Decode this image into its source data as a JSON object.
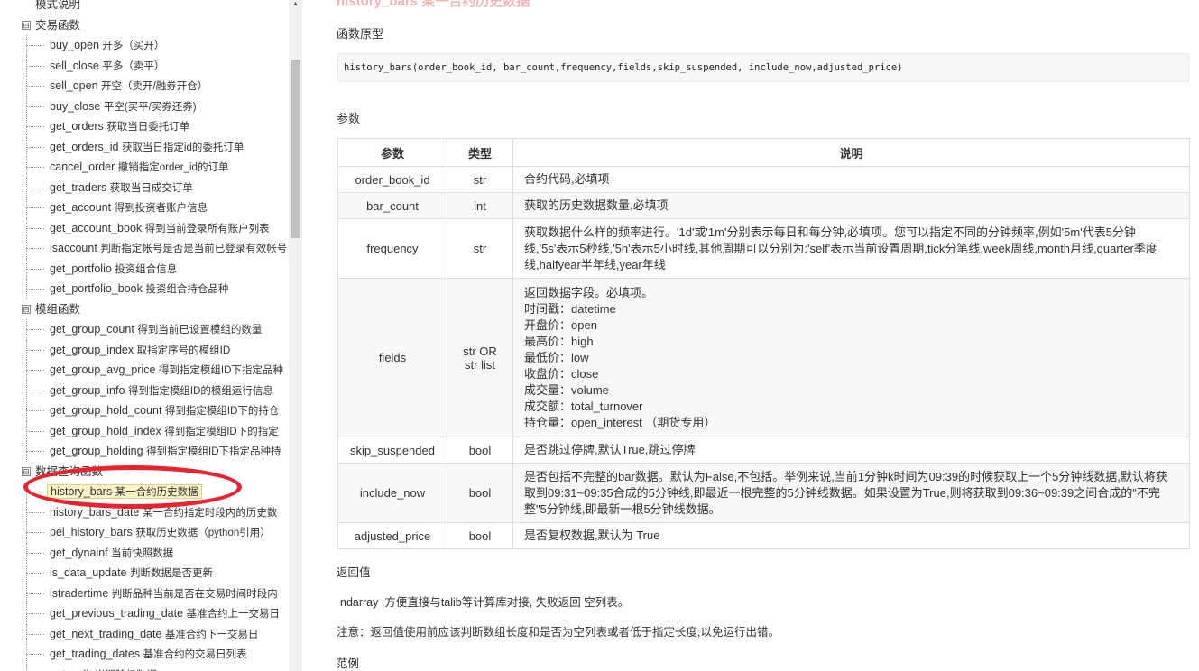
{
  "sidebar": {
    "items": [
      {
        "type": "top",
        "label": "模式说明",
        "desc": ""
      },
      {
        "type": "group",
        "label": "交易函数",
        "desc": "",
        "toggle": "⊟"
      },
      {
        "type": "leaf",
        "label": "buy_open",
        "desc": "开多（买开）"
      },
      {
        "type": "leaf",
        "label": "sell_close",
        "desc": "平多（卖平）"
      },
      {
        "type": "leaf",
        "label": "sell_open",
        "desc": "开空（卖开/融券开仓）"
      },
      {
        "type": "leaf",
        "label": "buy_close",
        "desc": "平空(买平/买券还券)"
      },
      {
        "type": "leaf",
        "label": "get_orders",
        "desc": "获取当日委托订单"
      },
      {
        "type": "leaf",
        "label": "get_orders_id",
        "desc": "获取当日指定id的委托订单"
      },
      {
        "type": "leaf",
        "label": "cancel_order",
        "desc": "撤销指定order_id的订单"
      },
      {
        "type": "leaf",
        "label": "get_traders",
        "desc": "获取当日成交订单"
      },
      {
        "type": "leaf",
        "label": "get_account",
        "desc": "得到投资者账户信息"
      },
      {
        "type": "leaf",
        "label": "get_account_book",
        "desc": "得到当前登录所有账户列表"
      },
      {
        "type": "leaf",
        "label": "isaccount",
        "desc": "判断指定帐号是否是当前已登录有效帐号"
      },
      {
        "type": "leaf",
        "label": "get_portfolio",
        "desc": "投资组合信息"
      },
      {
        "type": "leaf",
        "label": "get_portfolio_book",
        "desc": "投资组合持仓品种"
      },
      {
        "type": "group",
        "label": "模组函数",
        "desc": "",
        "toggle": "⊟"
      },
      {
        "type": "leaf",
        "label": "get_group_count",
        "desc": "得到当前已设置模组的数量"
      },
      {
        "type": "leaf",
        "label": "get_group_index",
        "desc": "取指定序号的模组ID"
      },
      {
        "type": "leaf",
        "label": "get_group_avg_price",
        "desc": "得到指定模组ID下指定品种"
      },
      {
        "type": "leaf",
        "label": "get_group_info",
        "desc": "得到指定模组ID的模组运行信息"
      },
      {
        "type": "leaf",
        "label": "get_group_hold_count",
        "desc": "得到指定模组ID下的持仓"
      },
      {
        "type": "leaf",
        "label": "get_group_hold_index",
        "desc": "得到指定模组ID下的指定"
      },
      {
        "type": "leaf",
        "label": "get_group_holding",
        "desc": "得到指定模组ID下指定品种持"
      },
      {
        "type": "group",
        "label": "数据查询函数",
        "desc": "",
        "toggle": "⊟"
      },
      {
        "type": "leaf",
        "label": "history_bars",
        "desc": "某一合约历史数据",
        "active": true
      },
      {
        "type": "leaf",
        "label": "history_bars_date",
        "desc": "某一合约指定时段内的历史数"
      },
      {
        "type": "leaf",
        "label": "pel_history_bars",
        "desc": "获取历史数据（python引用）"
      },
      {
        "type": "leaf",
        "label": "get_dynainf",
        "desc": "当前快照数据"
      },
      {
        "type": "leaf",
        "label": "is_data_update",
        "desc": "判断数据是否更新"
      },
      {
        "type": "leaf",
        "label": "istradertime",
        "desc": "判断品种当前是否在交易时间时段内"
      },
      {
        "type": "leaf",
        "label": "get_previous_trading_date",
        "desc": "基准合约上一交易日"
      },
      {
        "type": "leaf",
        "label": "get_next_trading_date",
        "desc": "基准合约下一交易日"
      },
      {
        "type": "leaf",
        "label": "get_trading_dates",
        "desc": "基准合约的交易日列表"
      },
      {
        "type": "leaf",
        "label": "get_split",
        "desc": "当期除权数据"
      }
    ]
  },
  "main": {
    "title": "history_bars 某一合约历史数据",
    "prototype_label": "函数原型",
    "prototype_code": "history_bars(order_book_id, bar_count,frequency,fields,skip_suspended, include_now,adjusted_price)",
    "params_label": "参数",
    "table": {
      "headers": [
        "参数",
        "类型",
        "说明"
      ],
      "rows": [
        {
          "name": "order_book_id",
          "type": "str",
          "desc": [
            "合约代码,必填项"
          ]
        },
        {
          "name": "bar_count",
          "type": "int",
          "desc": [
            "获取的历史数据数量,必填项"
          ]
        },
        {
          "name": "frequency",
          "type": "str",
          "desc": [
            "获取数据什么样的频率进行。'1d'或'1m'分别表示每日和每分钟,必填项。您可以指定不同的分钟频率,例如'5m'代表5分钟线,'5s'表示5秒线,'5h'表示5小时线,其他周期可以分别为:'self'表示当前设置周期,tick分笔线,week周线,month月线,quarter季度线,halfyear半年线,year年线"
          ]
        },
        {
          "name": "fields",
          "type": "str OR str list",
          "desc": [
            "返回数据字段。必填项。",
            "时间戳：datetime",
            "开盘价：open",
            "最高价：high",
            "最低价：low",
            "收盘价：close",
            "成交量：volume",
            "成交额：total_turnover",
            "持仓量：open_interest （期货专用）"
          ]
        },
        {
          "name": "skip_suspended",
          "type": "bool",
          "desc": [
            "是否跳过停牌,默认True,跳过停牌"
          ]
        },
        {
          "name": "include_now",
          "type": "bool",
          "desc": [
            "是否包括不完整的bar数据。默认为False,不包括。举例来说,当前1分钟k时间为09:39的时候获取上一个5分钟线数据,默认将获取到09:31~09:35合成的5分钟线,即最近一根完整的5分钟线数据。如果设置为True,则将获取到09:36~09:39之间合成的\"不完整\"5分钟线,即最新一根5分钟线数据。"
          ]
        },
        {
          "name": "adjusted_price",
          "type": "bool",
          "desc": [
            "是否复权数据,默认为 True"
          ]
        }
      ]
    },
    "return_label": "返回值",
    "return_text": "ndarray ,方便直接与talib等计算库对接, 失败返回 空列表。",
    "note_text": "注意：返回值使用前应该判断数组长度和是否为空列表或者低于指定长度,以免运行出错。",
    "example_label": "范例"
  },
  "colors": {
    "highlight_ring": "#e8232f",
    "active_bg": "#fff4c9",
    "title_faded": "#f2b3b3"
  }
}
